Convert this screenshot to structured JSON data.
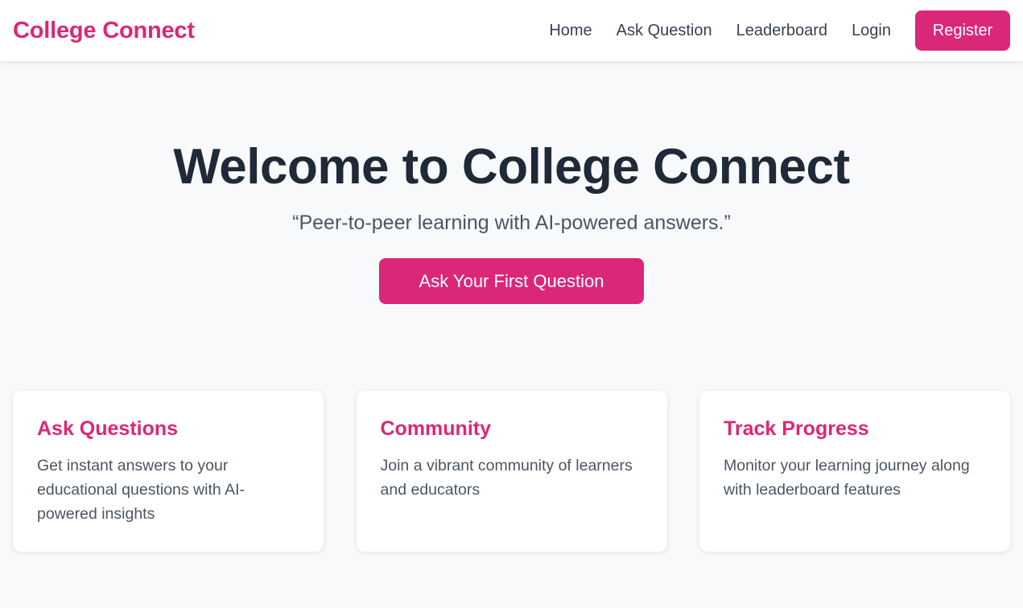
{
  "header": {
    "brand": "College Connect",
    "nav": {
      "home": "Home",
      "ask_question": "Ask Question",
      "leaderboard": "Leaderboard",
      "login": "Login",
      "register": "Register"
    }
  },
  "hero": {
    "title": "Welcome to College Connect",
    "subtitle": "“Peer-to-peer learning with AI-powered answers.”",
    "cta_label": "Ask Your First Question"
  },
  "features": [
    {
      "title": "Ask Questions",
      "text": "Get instant answers to your educational questions with AI-powered insights"
    },
    {
      "title": "Community",
      "text": "Join a vibrant community of learners and educators"
    },
    {
      "title": "Track Progress",
      "text": "Monitor your learning journey along with leaderboard features"
    }
  ],
  "colors": {
    "accent": "#db2777",
    "heading": "#1f2937",
    "body_text": "#4b5563",
    "background": "#f8f9fb"
  }
}
